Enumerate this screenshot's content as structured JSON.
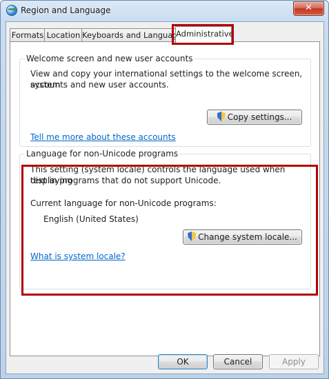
{
  "window": {
    "title": "Region and Language",
    "close_glyph": "✕"
  },
  "tabs": [
    {
      "label": "Formats"
    },
    {
      "label": "Location"
    },
    {
      "label": "Keyboards and Languages"
    },
    {
      "label": "Administrative"
    }
  ],
  "welcome_group": {
    "legend": "Welcome screen and new user accounts",
    "description_line1": "View and copy your international settings to the welcome screen, system",
    "description_line2": "accounts and new user accounts.",
    "copy_button": "Copy settings...",
    "link": "Tell me more about these accounts"
  },
  "locale_group": {
    "legend": "Language for non-Unicode programs",
    "description_line1": "This setting (system locale) controls the language used when displaying",
    "description_line2": "text in programs that do not support Unicode.",
    "current_label": "Current language for non-Unicode programs:",
    "current_value": "English (United States)",
    "change_button": "Change system locale...",
    "link": "What is system locale?"
  },
  "footer": {
    "ok": "OK",
    "cancel": "Cancel",
    "apply": "Apply"
  },
  "colors": {
    "highlight": "#b00000",
    "link": "#0066cc"
  },
  "icons": [
    "globe-icon",
    "close-icon",
    "shield-icon"
  ]
}
